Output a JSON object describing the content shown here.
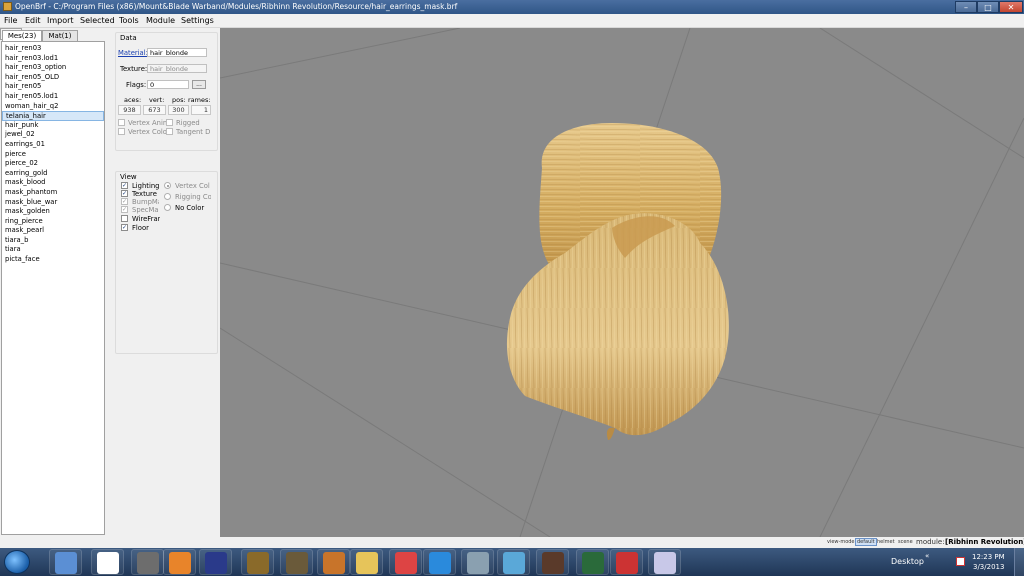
{
  "window": {
    "title": "OpenBrf - C:/Program Files (x86)/Mount&Blade Warband/Modules/Ribhinn Revolution/Resource/hair_earrings_mask.brf",
    "minimize": "–",
    "maximize": "□",
    "close": "✕"
  },
  "menu": [
    "File",
    "Edit",
    "Import",
    "Selected",
    "Tools",
    "Module",
    "Settings"
  ],
  "tabs": {
    "mes": "Mes(23)",
    "mat": "Mat(1)",
    "scroll": "◂ ▸"
  },
  "meshes": [
    "hair_ren03",
    "hair_ren03.lod1",
    "hair_ren03_option",
    "hair_ren05_OLD",
    "hair_ren05",
    "hair_ren05.lod1",
    "woman_hair_q2",
    "telania_hair",
    "hair_punk",
    "jewel_02",
    "earrings_01",
    "pierce",
    "pierce_02",
    "earring_gold",
    "mask_blood",
    "mask_phantom",
    "mask_blue_war",
    "mask_golden",
    "ring_pierce",
    "mask_pearl",
    "tiara_b",
    "tiara",
    "picta_face"
  ],
  "selected_index": 7,
  "data_panel": {
    "title": "Data",
    "material_label": "Material:",
    "material_value": "hair_blonde",
    "texture_label": "Texture:",
    "texture_value": "hair_blonde",
    "flags_label": "Flags:",
    "flags_value": "0",
    "flags_button": "...",
    "headers": {
      "faces": "aces:",
      "vert": "vert:",
      "pos": "pos:",
      "frames": "rames:"
    },
    "counts": {
      "faces": "938",
      "vert": "673",
      "pos": "300",
      "frames": "1"
    },
    "checks": {
      "vertex_anim": "Vertex Anim",
      "vertex_color": "Vertex Color",
      "rigged": "Rigged",
      "tangent": "Tangent D"
    }
  },
  "view_panel": {
    "title": "View",
    "lighting": "Lighting",
    "texture": "Texture",
    "bumpmap": "BumpMap",
    "specmap": "SpecMap",
    "wireframe": "WireFrame",
    "floor": "Floor",
    "vertex_color": "Vertex Col",
    "rigging_color": "Rigging Col",
    "no_color": "No Color"
  },
  "statusbar": {
    "view_mode": "view-mode:",
    "default": "default",
    "helmet": "helmet",
    "scene": "scene",
    "module_label": "module:",
    "module_value": "[Ribhinn Revolution]"
  },
  "taskbar": {
    "desktop": "Desktop",
    "chevron": "«",
    "time": "12:23 PM",
    "date": "3/3/2013",
    "app_icons": [
      "window-icon",
      "tv-icon",
      "shield-icon",
      "media-player-icon",
      "orb-icon",
      "warrior-icon",
      "knight-icon",
      "tools-icon",
      "folder-icon",
      "chrome-icon",
      "ie-icon",
      "monitor-icon",
      "notepad-icon",
      "horse-icon",
      "screen-icon",
      "emulator-icon",
      "paint-icon"
    ]
  },
  "colors": {
    "viewport": "#8a8a8a",
    "hair_light": "#e8c98a",
    "hair_dark": "#b88b45",
    "selection": "#d6e7f8"
  }
}
